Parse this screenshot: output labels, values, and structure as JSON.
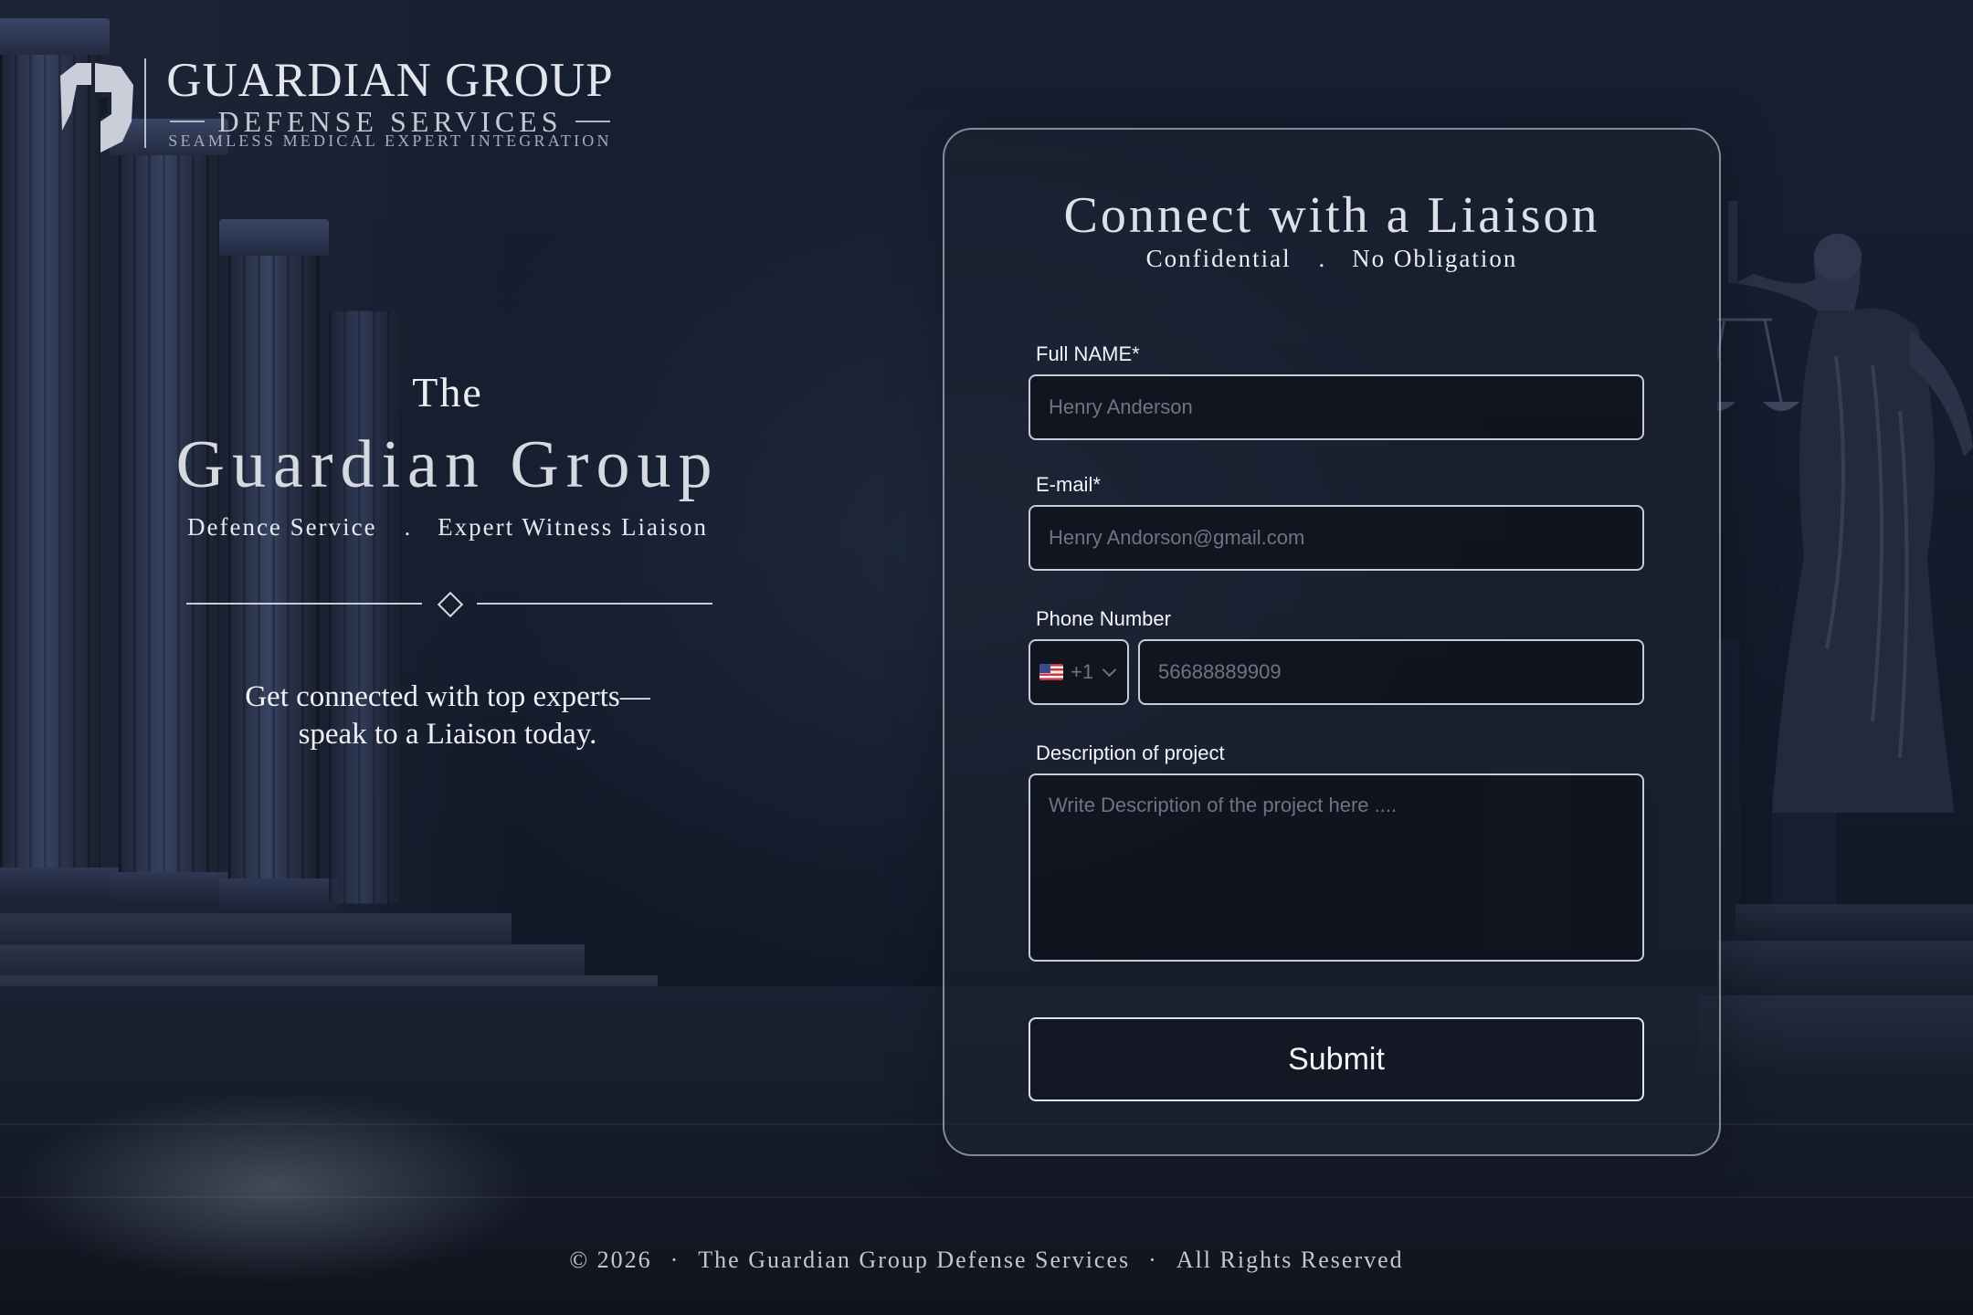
{
  "brand": {
    "title": "GUARDIAN GROUP",
    "subtitle": "DEFENSE SERVICES",
    "tagline": "SEAMLESS MEDICAL EXPERT INTEGRATION"
  },
  "hero": {
    "pre_title": "The",
    "title": "Guardian Group",
    "sub_left": "Defence Service",
    "sub_sep": ".",
    "sub_right": "Expert Witness Liaison",
    "tagline_line1": "Get connected with top experts—",
    "tagline_line2": "speak to a Liaison today."
  },
  "form": {
    "title": "Connect with a Liaison",
    "sub_left": "Confidential",
    "sub_sep": ".",
    "sub_right": "No Obligation",
    "full_name": {
      "label": "Full NAME*",
      "placeholder": "Henry Anderson"
    },
    "email": {
      "label": "E-mail*",
      "placeholder": "Henry Andorson@gmail.com"
    },
    "phone": {
      "label": "Phone Number",
      "country_code": "+1",
      "flag": "us-flag-icon",
      "placeholder": "56688889909"
    },
    "description": {
      "label": "Description of project",
      "placeholder": "Write Description of the project here ...."
    },
    "submit_label": "Submit"
  },
  "footer": {
    "copyright": "© 2026",
    "sep1": "·",
    "company": "The Guardian Group Defense Services",
    "sep2": "·",
    "rights": "All Rights Reserved"
  },
  "colors": {
    "background": "#131a28",
    "card_border": "#dce2ee",
    "input_bg": "#10131e",
    "text": "#eceef2"
  }
}
